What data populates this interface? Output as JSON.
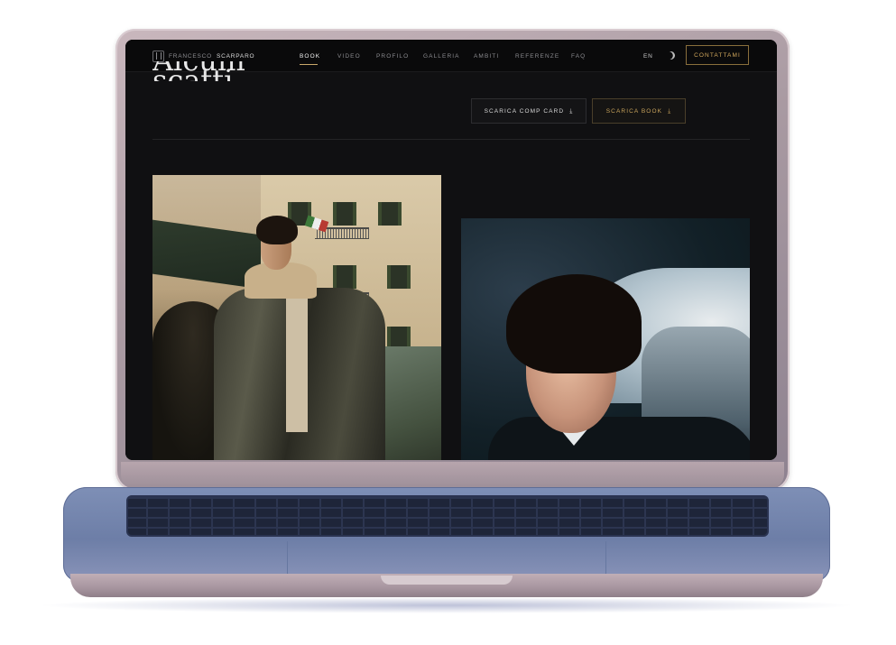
{
  "site": {
    "logo": {
      "first_name": "FRANCESCO",
      "last_name": "SCARPARO"
    },
    "nav": {
      "items": [
        {
          "label": "BOOK",
          "active": true
        },
        {
          "label": "VIDEO"
        },
        {
          "label": "PROFILO"
        },
        {
          "label": "GALLERIA"
        },
        {
          "label": "AMBITI"
        },
        {
          "label": "REFERENZE"
        },
        {
          "label": "FAQ"
        }
      ],
      "language": "EN",
      "theme_icon": "moon-icon",
      "contact_label": "CONTATTAMI"
    },
    "heading_partial": "Alcuni scatti",
    "downloads": {
      "comp_card_label": "SCARICA COMP CARD",
      "book_label": "SCARICA BOOK",
      "icon": "download-icon"
    },
    "colors": {
      "accent": "#c9a45c",
      "background": "#101012"
    }
  }
}
